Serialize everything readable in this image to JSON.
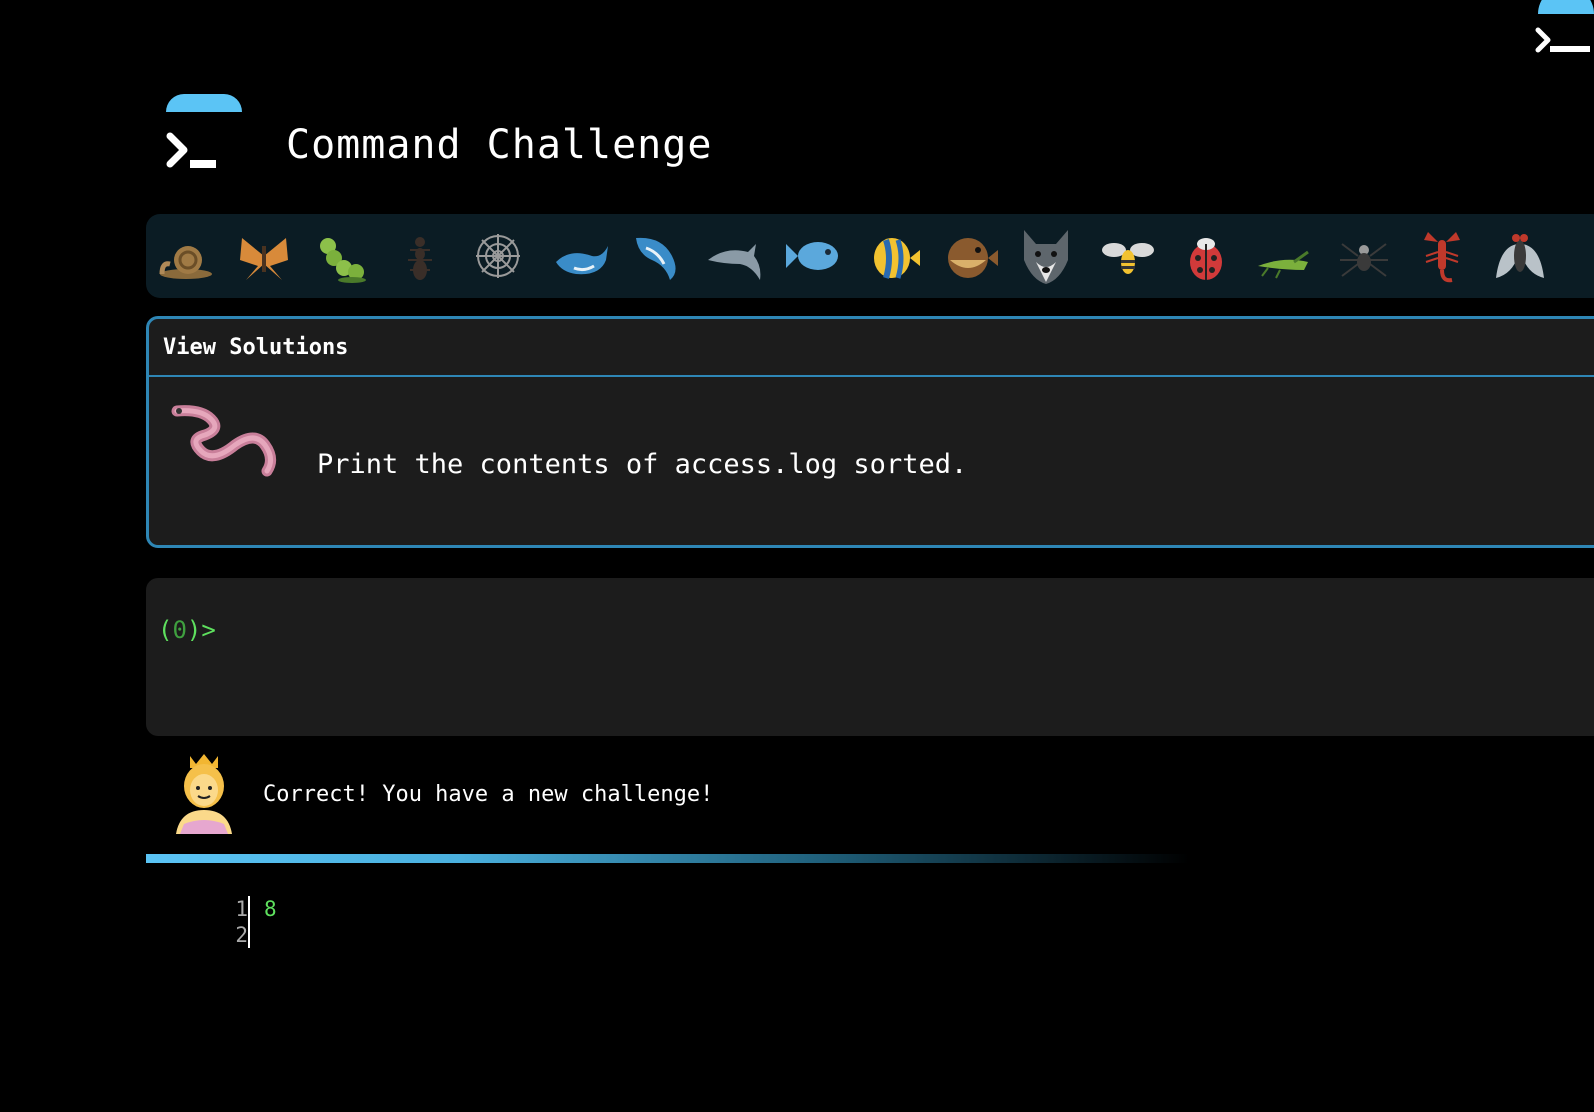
{
  "app": {
    "title": "Command Challenge",
    "logo_icon": "terminal-prompt-icon",
    "accent_color": "#5bc4f5"
  },
  "badges": [
    {
      "name": "snail",
      "icon": "snail-icon"
    },
    {
      "name": "butterfly",
      "icon": "butterfly-icon"
    },
    {
      "name": "caterpillar",
      "icon": "caterpillar-icon"
    },
    {
      "name": "ant",
      "icon": "ant-icon"
    },
    {
      "name": "spider-web",
      "icon": "spider-web-icon"
    },
    {
      "name": "whale",
      "icon": "whale-icon"
    },
    {
      "name": "whale-2",
      "icon": "whale-2-icon"
    },
    {
      "name": "dolphin",
      "icon": "dolphin-icon"
    },
    {
      "name": "fish",
      "icon": "fish-icon"
    },
    {
      "name": "tropical-fish",
      "icon": "tropical-fish-icon"
    },
    {
      "name": "blowfish",
      "icon": "blowfish-icon"
    },
    {
      "name": "wolf",
      "icon": "wolf-icon"
    },
    {
      "name": "bee",
      "icon": "bee-icon"
    },
    {
      "name": "ladybug",
      "icon": "ladybug-icon"
    },
    {
      "name": "cricket",
      "icon": "cricket-icon"
    },
    {
      "name": "spider",
      "icon": "spider-icon"
    },
    {
      "name": "scorpion",
      "icon": "scorpion-icon"
    },
    {
      "name": "fly",
      "icon": "fly-icon"
    }
  ],
  "challenge": {
    "view_solutions_label": "View Solutions",
    "task_icon": "worm-icon",
    "task_text": "Print the contents of access.log sorted."
  },
  "terminal": {
    "prompt_open": "(",
    "prompt_count": "0",
    "prompt_close": ")>",
    "input_value": ""
  },
  "feedback": {
    "icon": "princess-icon",
    "message": "Correct! You have a new challenge!"
  },
  "progress": {
    "fraction": 0.72
  },
  "output": {
    "line_numbers": "1\n2",
    "lines": "8"
  }
}
